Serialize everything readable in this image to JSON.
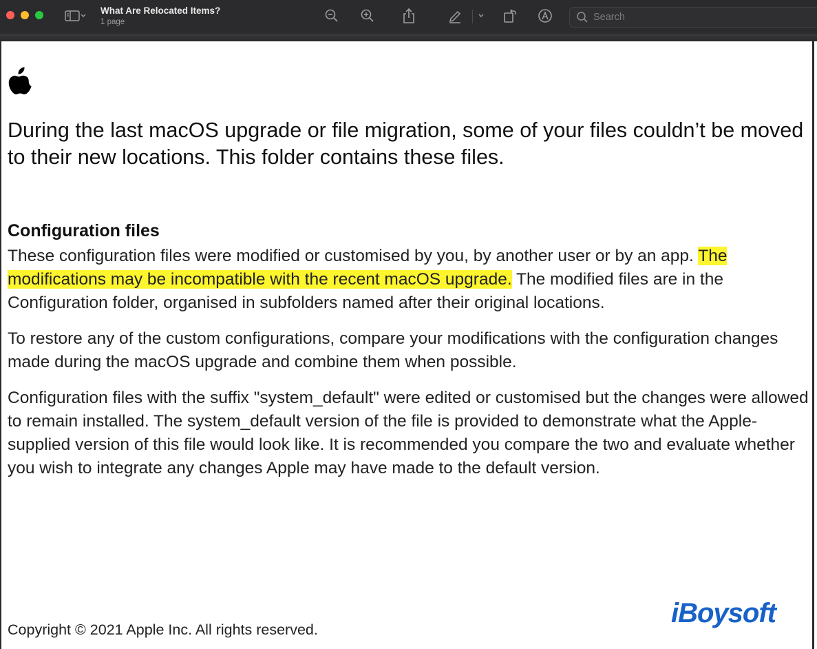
{
  "window": {
    "title": "What Are Relocated Items?",
    "subtitle": "1 page",
    "search_placeholder": "Search"
  },
  "toolbar": {
    "icons": [
      "sidebar-icon",
      "chevron-down-icon",
      "zoom-out-icon",
      "zoom-in-icon",
      "share-icon",
      "highlight-pen-icon",
      "chevron-down-icon",
      "rotate-icon",
      "markup-icon",
      "search-icon"
    ]
  },
  "document": {
    "intro": "During the last macOS upgrade or file migration, some of your files couldn’t be moved to their new locations. This folder contains these files.",
    "heading": "Configuration files",
    "para1_before": "These configuration files were modified or customised by you, by another user or by an app. ",
    "para1_highlight": "The modifications may be incompatible with the recent macOS upgrade.",
    "para1_after": " The modified files are in the Configuration folder, organised in subfolders named after their original locations.",
    "para2": "To restore any of the custom configurations, compare your modifications with the configuration changes made during the macOS upgrade and combine them when possible.",
    "para3": "Configuration files with the suffix \"system_default\" were edited or customised but the changes were allowed to remain installed. The system_default version of the file is provided to demonstrate what the Apple-supplied version of this file would look like. It is recommended you compare the two and evaluate whether you wish to integrate any changes Apple may have made to the default version.",
    "copyright": "Copyright © 2021 Apple Inc. All rights reserved."
  },
  "watermark": {
    "text": "iBoysoft",
    "color": "#1861c8"
  },
  "colors": {
    "highlight": "#fdf52e",
    "toolbar_bg": "#2b2b2d"
  }
}
